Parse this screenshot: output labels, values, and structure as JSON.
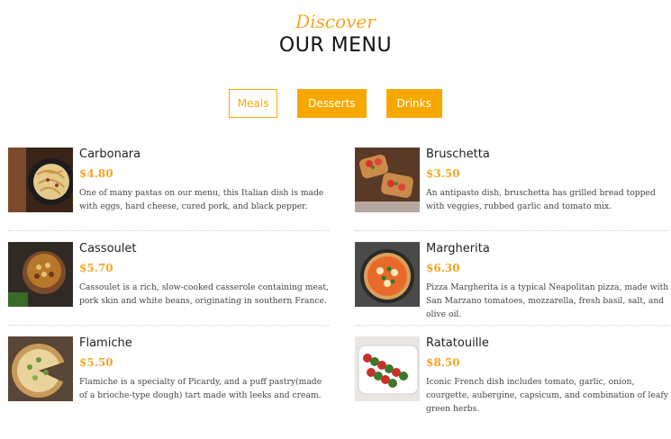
{
  "header": {
    "kicker": "Discover",
    "title": "OUR MENU"
  },
  "tabs": [
    {
      "label": "Meals",
      "active": true
    },
    {
      "label": "Desserts",
      "active": false
    },
    {
      "label": "Drinks",
      "active": false
    }
  ],
  "colors": {
    "accent": "#f7a800",
    "price": "#f5a623"
  },
  "items": [
    {
      "name": "Carbonara",
      "price": "$4.80",
      "desc": "One of many pastas on our menu, this Italian dish is made with eggs, hard cheese, cured pork, and black pepper.",
      "image": "carbonara-photo"
    },
    {
      "name": "Bruschetta",
      "price": "$3.50",
      "desc": "An antipasto dish, bruschetta has grilled bread topped with veggies, rubbed garlic and tomato mix.",
      "image": "bruschetta-photo"
    },
    {
      "name": "Cassoulet",
      "price": "$5.70",
      "desc": "Cassoulet is a rich, slow-cooked casserole containing meat, pork skin and white beans, originating in southern France.",
      "image": "cassoulet-photo"
    },
    {
      "name": "Margherita",
      "price": "$6.30",
      "desc": "Pizza Margherita is a typical Neapolitan pizza, made with San Marzano tomatoes, mozzarella, fresh basil, salt, and olive oil.",
      "image": "margherita-photo"
    },
    {
      "name": "Flamiche",
      "price": "$5.50",
      "desc": "Flamiche is a specialty of Picardy, and a puff pastry(made of a brioche-type dough) tart made with leeks and cream.",
      "image": "flamiche-photo"
    },
    {
      "name": "Ratatouille",
      "price": "$8.50",
      "desc": "Iconic French dish includes tomato, garlic, onion, courgette, aubergine, capsicum, and combination of leafy green herbs.",
      "image": "ratatouille-photo"
    }
  ]
}
